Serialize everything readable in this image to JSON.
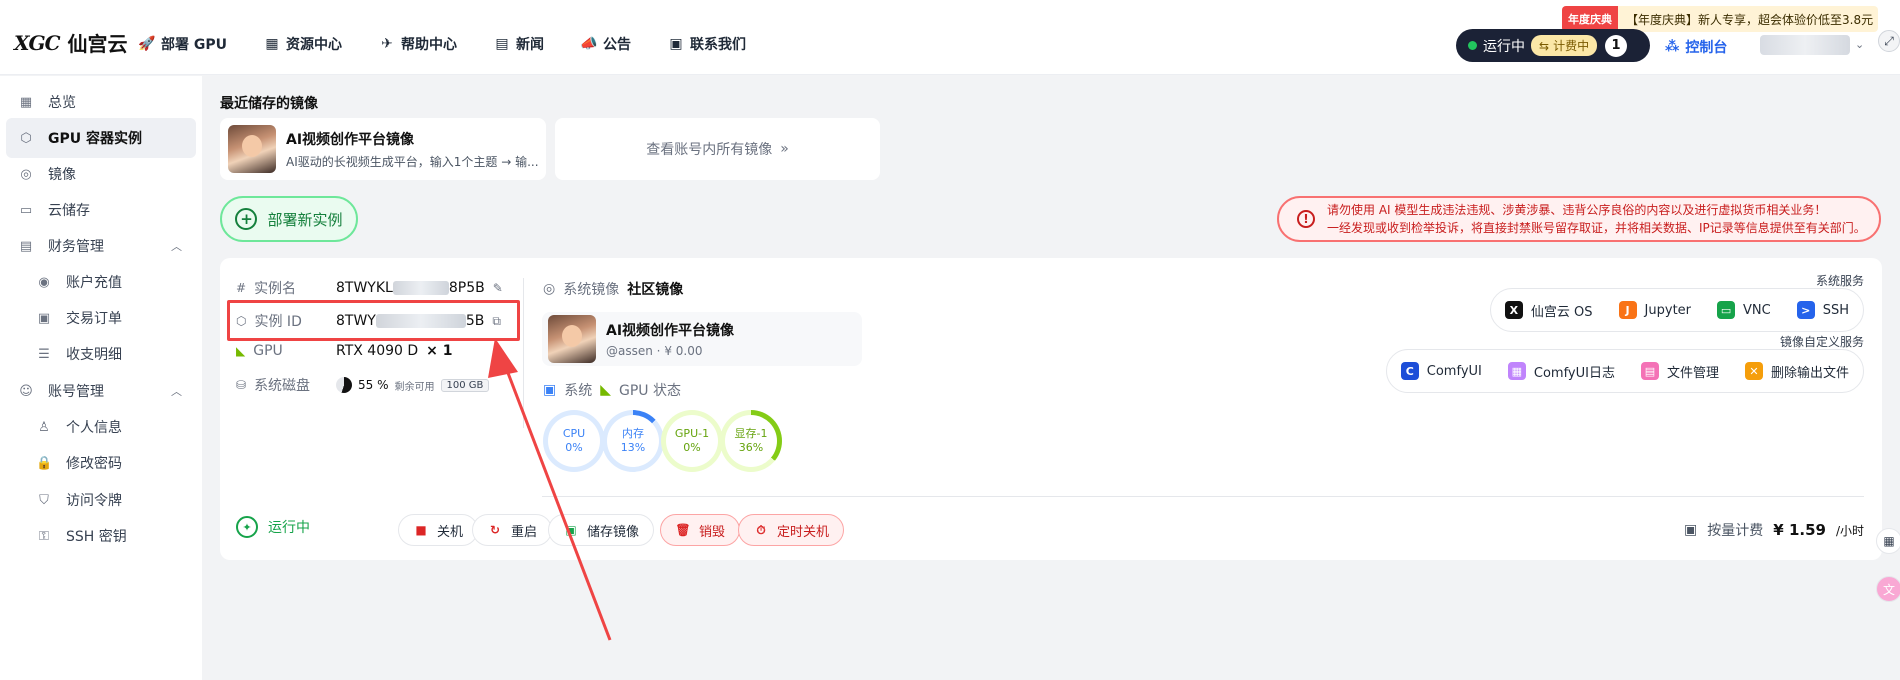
{
  "header": {
    "logo_mark": "XGC",
    "logo_text": "仙宫云",
    "nav": [
      {
        "label": "部署 GPU",
        "icon": "rocket-icon",
        "glyph": "🚀"
      },
      {
        "label": "资源中心",
        "icon": "grid-icon",
        "glyph": "▦"
      },
      {
        "label": "帮助中心",
        "icon": "help-icon",
        "glyph": "✈"
      },
      {
        "label": "新闻",
        "icon": "news-icon",
        "glyph": "▤"
      },
      {
        "label": "公告",
        "icon": "megaphone-icon",
        "glyph": "📣"
      },
      {
        "label": "联系我们",
        "icon": "chat-icon",
        "glyph": "▣"
      }
    ],
    "status_label": "运行中",
    "billing_label": "计费中",
    "running_count": "1",
    "console_label": "控制台",
    "promo_tag": "年度庆典",
    "promo_text": "【年度庆典】新人专享，超会体验价低至3.8元"
  },
  "sidebar": {
    "items": [
      {
        "label": "总览",
        "glyph": "▦"
      },
      {
        "label": "GPU 容器实例",
        "glyph": "⬡"
      },
      {
        "label": "镜像",
        "glyph": "◎"
      },
      {
        "label": "云储存",
        "glyph": "▭"
      },
      {
        "label": "财务管理",
        "glyph": "▤"
      },
      {
        "label": "账户充值",
        "glyph": "◉"
      },
      {
        "label": "交易订单",
        "glyph": "▣"
      },
      {
        "label": "收支明细",
        "glyph": "☰"
      },
      {
        "label": "账号管理",
        "glyph": "☺"
      },
      {
        "label": "个人信息",
        "glyph": "♙"
      },
      {
        "label": "修改密码",
        "glyph": "🔒"
      },
      {
        "label": "访问令牌",
        "glyph": "⛉"
      },
      {
        "label": "SSH 密钥",
        "glyph": "⚿"
      }
    ]
  },
  "main": {
    "recent_title": "最近储存的镜像",
    "recent_card": {
      "title": "AI视频创作平台镜像",
      "desc": "AI驱动的长视频生成平台，输入1个主题 → 输..."
    },
    "view_all": "查看账号内所有镜像",
    "deploy_label": "部署新实例",
    "warning_line1": "请勿使用 AI 模型生成违法违规、涉黄涉暴、违背公序良俗的内容以及进行虚拟货币相关业务！",
    "warning_line2": "一经发现或收到检举投诉，将直接封禁账号留存取证，并将相关数据、IP记录等信息提供至有关部门。"
  },
  "instance": {
    "name_label": "实例名",
    "name_prefix": "8TWYKL",
    "name_suffix": "8P5B",
    "id_label": "实例 ID",
    "id_prefix": "8TWY",
    "id_suffix": "5B",
    "gpu_label": "GPU",
    "gpu_value": "RTX 4090 D",
    "gpu_multiplier": "× 1",
    "disk_label": "系统磁盘",
    "disk_percent": "55 %",
    "disk_free_label": "剩余可用",
    "disk_size": "100 GB",
    "sys_image_label": "系统镜像",
    "sys_image_value": "社区镜像",
    "mirror": {
      "title": "AI视频创作平台镜像",
      "author": "@assen",
      "price": "¥ 0.00"
    },
    "sys_label": "系统",
    "gpu_state_label": "GPU 状态",
    "gauges": [
      {
        "name": "CPU",
        "value": "0%",
        "percent": 0,
        "color": "#3b82f6",
        "track": "#dbeafe",
        "text": "#3b82f6"
      },
      {
        "name": "内存",
        "value": "13%",
        "percent": 13,
        "color": "#3b82f6",
        "track": "#dbeafe",
        "text": "#3b82f6"
      },
      {
        "name": "GPU-1",
        "value": "0%",
        "percent": 0,
        "color": "#84cc16",
        "track": "#ecfccb",
        "text": "#65a30d"
      },
      {
        "name": "显存-1",
        "value": "36%",
        "percent": 36,
        "color": "#84cc16",
        "track": "#ecfccb",
        "text": "#65a30d"
      }
    ],
    "system_services_title": "系统服务",
    "system_services": [
      {
        "label": "仙宫云 OS",
        "icon": "xgc-os-icon",
        "glyph": "X",
        "bg": "#111111"
      },
      {
        "label": "Jupyter",
        "icon": "jupyter-icon",
        "glyph": "J",
        "bg": "#f97316"
      },
      {
        "label": "VNC",
        "icon": "monitor-icon",
        "glyph": "▭",
        "bg": "#16a34a"
      },
      {
        "label": "SSH",
        "icon": "terminal-icon",
        "glyph": ">",
        "bg": "#2563eb"
      }
    ],
    "custom_services_title": "镜像自定义服务",
    "custom_services": [
      {
        "label": "ComfyUI",
        "icon": "comfyui-icon",
        "glyph": "C",
        "bg": "#1d4ed8"
      },
      {
        "label": "ComfyUI日志",
        "icon": "calendar-icon",
        "glyph": "▦",
        "bg": "#c084fc"
      },
      {
        "label": "文件管理",
        "icon": "file-manager-icon",
        "glyph": "▤",
        "bg": "#f472b6"
      },
      {
        "label": "删除输出文件",
        "icon": "folder-delete-icon",
        "glyph": "✕",
        "bg": "#f59e0b"
      }
    ],
    "status": "运行中",
    "actions": [
      {
        "label": "关机",
        "icon": "power-off-icon",
        "glyph": "■",
        "danger": false,
        "color": "#dc2626"
      },
      {
        "label": "重启",
        "icon": "restart-icon",
        "glyph": "↻",
        "danger": false,
        "color": "#dc2626"
      },
      {
        "label": "储存镜像",
        "icon": "save-icon",
        "glyph": "▣",
        "danger": false,
        "color": "#16a34a"
      },
      {
        "label": "销毁",
        "icon": "trash-icon",
        "glyph": "🗑",
        "danger": true,
        "color": "#dc2626"
      },
      {
        "label": "定时关机",
        "icon": "timer-icon",
        "glyph": "⏱",
        "danger": true,
        "color": "#dc2626"
      }
    ],
    "billing_mode": "按量计费",
    "price": "¥ 1.59",
    "price_unit": "/小时"
  }
}
